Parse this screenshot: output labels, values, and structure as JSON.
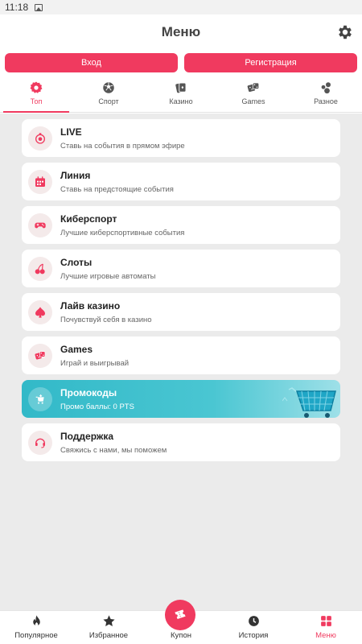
{
  "status": {
    "time": "11:18"
  },
  "header": {
    "title": "Меню"
  },
  "auth": {
    "login": "Вход",
    "register": "Регистрация"
  },
  "tabs": [
    {
      "label": "Топ",
      "icon": "top-badge-icon",
      "active": true
    },
    {
      "label": "Спорт",
      "icon": "ball-icon",
      "active": false
    },
    {
      "label": "Казино",
      "icon": "cards-icon",
      "active": false
    },
    {
      "label": "Games",
      "icon": "dice-icon",
      "active": false
    },
    {
      "label": "Разное",
      "icon": "bubbles-icon",
      "active": false
    }
  ],
  "menu": [
    {
      "title": "LIVE",
      "subtitle": "Ставь на события в прямом эфире",
      "icon": "stopwatch-icon"
    },
    {
      "title": "Линия",
      "subtitle": "Ставь на предстоящие события",
      "icon": "calendar-icon"
    },
    {
      "title": "Киберспорт",
      "subtitle": "Лучшие киберспортивные события",
      "icon": "gamepad-icon"
    },
    {
      "title": "Слоты",
      "subtitle": "Лучшие игровые автоматы",
      "icon": "cherry-icon"
    },
    {
      "title": "Лайв казино",
      "subtitle": "Почувствуй себя в казино",
      "icon": "spade-icon"
    },
    {
      "title": "Games",
      "subtitle": "Играй и выигрывай",
      "icon": "dice-icon"
    },
    {
      "title": "Промокоды",
      "subtitle": "Промо баллы: 0 PTS",
      "icon": "cart-icon"
    },
    {
      "title": "Поддержка",
      "subtitle": "Свяжись с нами, мы поможем",
      "icon": "headset-icon"
    }
  ],
  "bottom_nav": [
    {
      "label": "Популярное",
      "icon": "flame-icon"
    },
    {
      "label": "Избранное",
      "icon": "star-icon"
    },
    {
      "label": "Купон",
      "icon": "ticket-icon"
    },
    {
      "label": "История",
      "icon": "clock-icon"
    },
    {
      "label": "Меню",
      "icon": "grid-icon",
      "active": true
    }
  ],
  "colors": {
    "accent": "#f03a5f",
    "promo": "#3bbdcb",
    "background": "#ebebeb"
  }
}
